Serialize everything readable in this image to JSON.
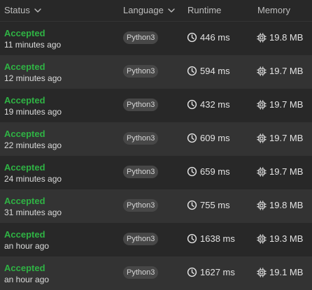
{
  "header": {
    "status_label": "Status",
    "language_label": "Language",
    "runtime_label": "Runtime",
    "memory_label": "Memory"
  },
  "colors": {
    "accepted": "#2fb344",
    "row_alt": "#333333",
    "row_base": "#282828"
  },
  "rows": [
    {
      "verdict": "Accepted",
      "time_ago": "11 minutes ago",
      "language": "Python3",
      "runtime": "446 ms",
      "memory": "19.8 MB"
    },
    {
      "verdict": "Accepted",
      "time_ago": "12 minutes ago",
      "language": "Python3",
      "runtime": "594 ms",
      "memory": "19.7 MB"
    },
    {
      "verdict": "Accepted",
      "time_ago": "19 minutes ago",
      "language": "Python3",
      "runtime": "432 ms",
      "memory": "19.7 MB"
    },
    {
      "verdict": "Accepted",
      "time_ago": "22 minutes ago",
      "language": "Python3",
      "runtime": "609 ms",
      "memory": "19.7 MB"
    },
    {
      "verdict": "Accepted",
      "time_ago": "24 minutes ago",
      "language": "Python3",
      "runtime": "659 ms",
      "memory": "19.7 MB"
    },
    {
      "verdict": "Accepted",
      "time_ago": "31 minutes ago",
      "language": "Python3",
      "runtime": "755 ms",
      "memory": "19.8 MB"
    },
    {
      "verdict": "Accepted",
      "time_ago": "an hour ago",
      "language": "Python3",
      "runtime": "1638 ms",
      "memory": "19.3 MB"
    },
    {
      "verdict": "Accepted",
      "time_ago": "an hour ago",
      "language": "Python3",
      "runtime": "1627 ms",
      "memory": "19.1 MB"
    }
  ]
}
